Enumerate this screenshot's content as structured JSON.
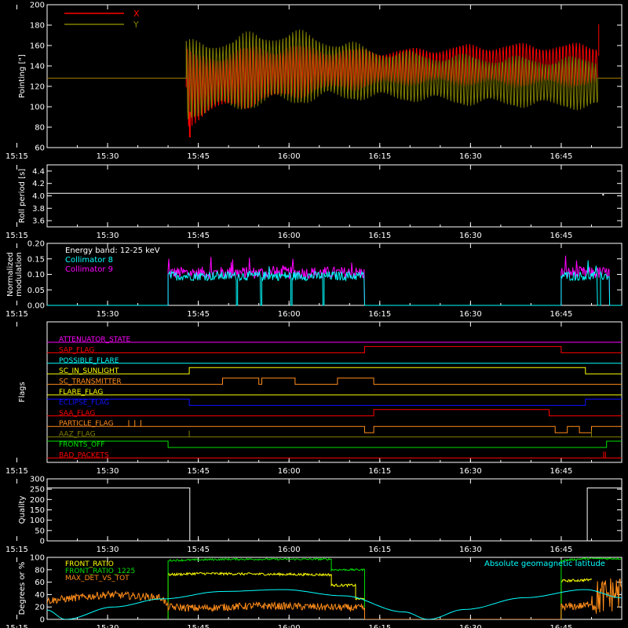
{
  "figure": {
    "time_ticks": [
      "15:15",
      "15:30",
      "15:45",
      "16:00",
      "16:15",
      "16:30",
      "16:45"
    ],
    "colors": {
      "background": "#000000",
      "axis": "#ffffff",
      "red": "#ff0000",
      "olive": "#808000",
      "cyan": "#00ffff",
      "magenta": "#ff00ff",
      "yellow": "#ffff00",
      "orange": "#ff8c1a",
      "green": "#00e000",
      "blue": "#1010ff"
    }
  },
  "chart_data": [
    {
      "id": "pointing",
      "type": "line",
      "ylabel": "Pointing [\"]",
      "ylim": [
        60,
        200
      ],
      "yticks": [
        60,
        80,
        100,
        120,
        140,
        160,
        180,
        200
      ],
      "xlim_min": [
        5.0,
        100.0
      ],
      "legend_position": "top-left",
      "series": [
        {
          "name": "X",
          "color": "#ff0000",
          "points": [
            [
              5,
              128
            ],
            [
              28,
              128
            ],
            [
              28,
              70
            ],
            [
              28,
              175
            ],
            [
              30,
              73
            ],
            [
              31,
              166
            ],
            [
              35,
              90
            ],
            [
              45,
              160
            ],
            [
              55,
              155
            ],
            [
              65,
              150
            ],
            [
              75,
              152
            ],
            [
              85,
              155
            ],
            [
              90,
              158
            ],
            [
              95,
              160
            ],
            [
              96.2,
              181
            ],
            [
              96.2,
              128
            ],
            [
              100,
              128
            ]
          ]
        },
        {
          "name": "Y",
          "color": "#808000",
          "points": [
            [
              5,
              128
            ],
            [
              28,
              128
            ],
            [
              28,
              170
            ],
            [
              30,
              80
            ],
            [
              45,
              178
            ],
            [
              55,
              168
            ],
            [
              60,
              160
            ],
            [
              75,
              155
            ],
            [
              95,
              148
            ],
            [
              96.2,
              92
            ],
            [
              96.2,
              128
            ],
            [
              100,
              128
            ]
          ]
        }
      ],
      "band_envelopes": {
        "X": {
          "x": [
            28,
            30,
            35,
            40,
            45,
            50,
            55,
            60,
            65,
            70,
            75,
            80,
            85,
            90,
            96
          ],
          "upper": [
            160,
            152,
            158,
            162,
            163,
            160,
            158,
            157,
            158,
            160,
            162,
            163,
            163,
            163,
            163
          ],
          "lower": [
            78,
            85,
            95,
            100,
            106,
            112,
            115,
            118,
            120,
            120,
            119,
            118,
            118,
            118,
            118
          ]
        },
        "Y": {
          "x": [
            28,
            30,
            35,
            40,
            45,
            50,
            55,
            60,
            65,
            70,
            75,
            80,
            85,
            90,
            96
          ],
          "upper": [
            168,
            165,
            172,
            175,
            178,
            172,
            165,
            158,
            155,
            153,
            152,
            151,
            150,
            150,
            150
          ],
          "lower": [
            85,
            88,
            93,
            97,
            100,
            103,
            105,
            105,
            104,
            102,
            100,
            99,
            98,
            97,
            95
          ]
        }
      }
    },
    {
      "id": "roll",
      "type": "line",
      "ylabel": "Roll period [s]",
      "ylim": [
        3.5,
        4.5
      ],
      "yticks": [
        3.6,
        3.8,
        4.0,
        4.2,
        4.4
      ],
      "series": [
        {
          "name": "",
          "color": "#ffffff",
          "points": [
            [
              5,
              4.04
            ],
            [
              100,
              4.04
            ]
          ]
        }
      ]
    },
    {
      "id": "modulation",
      "type": "line",
      "ylabel": "Normalized modulation",
      "ylim": [
        0,
        0.2
      ],
      "yticks": [
        0.0,
        0.05,
        0.1,
        0.15,
        0.2
      ],
      "legend_title": "Energy band: 12-25 keV",
      "series": [
        {
          "name": "Collimator 8",
          "color": "#00ffff",
          "segments": [
            [
              25,
              36.3
            ],
            [
              36.5,
              40.3
            ],
            [
              40.5,
              45.3
            ],
            [
              45.5,
              50.6
            ],
            [
              50.8,
              57.5
            ],
            [
              90,
              96
            ],
            [
              96.5,
              98
            ]
          ],
          "mean": 0.095,
          "spread": 0.015
        },
        {
          "name": "Collimator 9",
          "color": "#ff00ff",
          "segments": [
            [
              25,
              57.5
            ],
            [
              90,
              98
            ]
          ],
          "mean": 0.105,
          "spread": 0.02
        }
      ]
    },
    {
      "id": "flags",
      "type": "line",
      "ylabel": "Flags",
      "ylim": [
        0,
        13
      ],
      "series": [
        {
          "name": "ATTENUATOR_STATE",
          "color": "#ff00ff",
          "steps": [
            [
              5,
              0
            ]
          ]
        },
        {
          "name": "SAP_FLAG",
          "color": "#ff0000",
          "steps": [
            [
              5,
              0
            ],
            [
              57.5,
              1
            ],
            [
              90,
              0
            ]
          ]
        },
        {
          "name": "POSSIBLE_FLARE",
          "color": "#00ffff",
          "steps": [
            [
              5,
              0
            ]
          ]
        },
        {
          "name": "SC_IN_SUNLIGHT",
          "color": "#ffff00",
          "steps": [
            [
              5,
              0
            ],
            [
              28.5,
              1
            ],
            [
              94,
              0
            ]
          ]
        },
        {
          "name": "SC_TRANSMITTER",
          "color": "#ff8c1a",
          "steps": [
            [
              5,
              0
            ],
            [
              34,
              1
            ],
            [
              40,
              0
            ],
            [
              40.5,
              1
            ],
            [
              46,
              0
            ],
            [
              53,
              1
            ],
            [
              59,
              0
            ]
          ]
        },
        {
          "name": "FLARE_FLAG",
          "color": "#ffff00",
          "steps": [
            [
              5,
              0
            ]
          ]
        },
        {
          "name": "ECLIPSE_FLAG",
          "color": "#1010ff",
          "steps": [
            [
              5,
              1
            ],
            [
              28.5,
              0
            ],
            [
              94,
              1
            ]
          ]
        },
        {
          "name": "SAA_FLAG",
          "color": "#ff0000",
          "steps": [
            [
              5,
              0
            ],
            [
              59,
              1
            ],
            [
              88,
              0
            ]
          ]
        },
        {
          "name": "PARTICLE_FLAG",
          "color": "#ff8c1a",
          "steps": [
            [
              5,
              0
            ],
            [
              57.5,
              -1
            ],
            [
              59,
              0
            ],
            [
              89,
              -1
            ],
            [
              91,
              0
            ],
            [
              93,
              -1
            ],
            [
              95,
              0
            ]
          ],
          "spikes": [
            18.5,
            19.5,
            20.5
          ]
        },
        {
          "name": "AAZ_FLAG",
          "color": "#808000",
          "steps": [
            [
              5,
              0
            ]
          ],
          "spikes": [
            28.5,
            95
          ]
        },
        {
          "name": "FRONTS_OFF",
          "color": "#00e000",
          "steps": [
            [
              5,
              1
            ],
            [
              25,
              0
            ],
            [
              97.5,
              1
            ]
          ]
        },
        {
          "name": "BAD_PACKETS",
          "color": "#ff0000",
          "steps": [
            [
              5,
              0
            ]
          ],
          "spikes": [
            97,
            97.3
          ]
        }
      ]
    },
    {
      "id": "quality",
      "type": "line",
      "ylabel": "Quality",
      "ylim": [
        0,
        300
      ],
      "yticks": [
        0,
        50,
        100,
        150,
        200,
        250,
        300
      ],
      "series": [
        {
          "name": "",
          "color": "#ffffff",
          "points": [
            [
              5,
              256
            ],
            [
              28.6,
              256
            ],
            [
              28.6,
              0
            ],
            [
              94.3,
              0
            ],
            [
              94.3,
              256
            ],
            [
              100,
              256
            ]
          ]
        }
      ]
    },
    {
      "id": "ratios",
      "type": "line",
      "ylabel": "Degrees or %",
      "ylim": [
        0,
        100
      ],
      "yticks": [
        0,
        20,
        40,
        60,
        80,
        100
      ],
      "series": [
        {
          "name": "FRONT_RATIO",
          "color": "#ffff00",
          "points": [
            [
              25,
              0
            ],
            [
              25,
              72
            ],
            [
              30,
              74
            ],
            [
              40,
              73
            ],
            [
              52,
              72
            ],
            [
              52,
              55
            ],
            [
              56,
              55
            ],
            [
              56,
              33
            ],
            [
              57.5,
              33
            ],
            [
              57.5,
              0
            ],
            [
              90,
              0
            ],
            [
              90,
              62
            ],
            [
              93,
              63
            ],
            [
              95,
              64
            ]
          ]
        },
        {
          "name": "FRONT_RATIO_1225",
          "color": "#00e000",
          "points": [
            [
              25,
              0
            ],
            [
              25,
              95
            ],
            [
              35,
              97
            ],
            [
              50,
              97
            ],
            [
              52,
              97
            ],
            [
              52,
              80
            ],
            [
              57.5,
              80
            ],
            [
              57.5,
              0
            ],
            [
              90,
              0
            ],
            [
              90,
              95
            ],
            [
              94,
              98
            ],
            [
              98,
              98
            ],
            [
              100,
              98
            ]
          ]
        },
        {
          "name": "MAX_DET_VS_TOT",
          "color": "#ff8c1a",
          "points": [
            [
              5,
              30
            ],
            [
              15,
              40
            ],
            [
              24,
              35
            ],
            [
              25,
              20
            ],
            [
              30,
              18
            ],
            [
              40,
              22
            ],
            [
              50,
              20
            ],
            [
              57.5,
              18
            ],
            [
              57.5,
              0
            ],
            [
              90,
              0
            ],
            [
              90,
              20
            ],
            [
              94,
              22
            ],
            [
              96,
              35
            ],
            [
              100,
              45
            ]
          ]
        },
        {
          "name": "Absolute geomagnetic latitude",
          "color": "#00ffff",
          "points": [
            [
              5,
              15
            ],
            [
              8,
              0
            ],
            [
              16,
              20
            ],
            [
              24,
              33
            ],
            [
              34,
              45
            ],
            [
              44,
              48
            ],
            [
              54,
              38
            ],
            [
              64,
              12
            ],
            [
              68,
              0
            ],
            [
              74,
              16
            ],
            [
              84,
              35
            ],
            [
              94,
              48
            ],
            [
              100,
              35
            ]
          ]
        }
      ]
    }
  ]
}
